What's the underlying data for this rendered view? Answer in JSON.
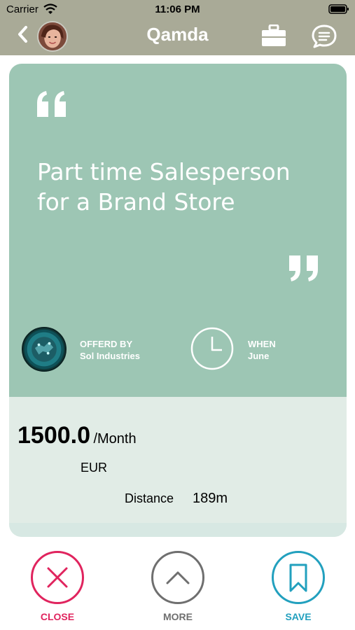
{
  "status_bar": {
    "carrier": "Carrier",
    "time": "11:06 PM"
  },
  "nav": {
    "title": "Qamda",
    "icons": [
      "back-icon",
      "avatar",
      "briefcase-icon",
      "chat-icon"
    ]
  },
  "job": {
    "title": "Part time Salesperson for a Brand Store",
    "offered_by_label": "OFFERD BY",
    "company": "Sol Industries",
    "when_label": "WHEN",
    "when": "June",
    "salary_amount": "1500.0",
    "salary_unit": "/Month",
    "currency": "EUR",
    "distance_label": "Distance",
    "distance": "189m"
  },
  "actions": {
    "close": "CLOSE",
    "more": "MORE",
    "save": "SAVE"
  },
  "colors": {
    "header": "#a9aa97",
    "card_top": "#9dc6b4",
    "card_bottom": "#e1ece6",
    "close": "#e0245e",
    "more": "#6f6f6f",
    "save": "#22a0be"
  }
}
